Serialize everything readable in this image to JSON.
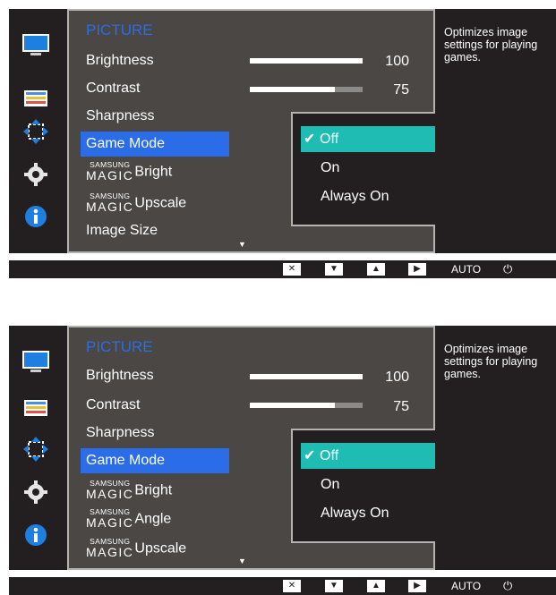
{
  "colors": {
    "accent_blue": "#2b6ce8",
    "selected_teal": "#1fbcb4",
    "panel_gray": "#4a4744",
    "dark": "#231f20"
  },
  "icons": [
    "monitor-icon",
    "color-bars-icon",
    "resize-arrows-icon",
    "gear-icon",
    "info-icon"
  ],
  "screen1": {
    "category": "PICTURE",
    "help_text": "Optimizes image settings for playing games.",
    "menu": {
      "brightness": "Brightness",
      "brightness_value": "100",
      "brightness_level": 100,
      "contrast": "Contrast",
      "contrast_value": "75",
      "contrast_level": 75,
      "sharpness": "Sharpness",
      "game_mode": "Game Mode",
      "magic_bright": "Bright",
      "magic_upscale": "Upscale",
      "image_size": "Image Size"
    },
    "submenu": {
      "off": "Off",
      "on": "On",
      "always_on": "Always On"
    }
  },
  "screen2": {
    "category": "PICTURE",
    "help_text": "Optimizes image settings for playing games.",
    "menu": {
      "brightness": "Brightness",
      "brightness_value": "100",
      "brightness_level": 100,
      "contrast": "Contrast",
      "contrast_value": "75",
      "contrast_level": 75,
      "sharpness": "Sharpness",
      "game_mode": "Game Mode",
      "magic_bright": "Bright",
      "magic_angle": "Angle",
      "magic_upscale": "Upscale"
    },
    "submenu": {
      "off": "Off",
      "on": "On",
      "always_on": "Always On"
    }
  },
  "magic_brand": {
    "small": "SAMSUNG",
    "big": "MAGIC"
  },
  "keys": {
    "auto": "AUTO"
  }
}
